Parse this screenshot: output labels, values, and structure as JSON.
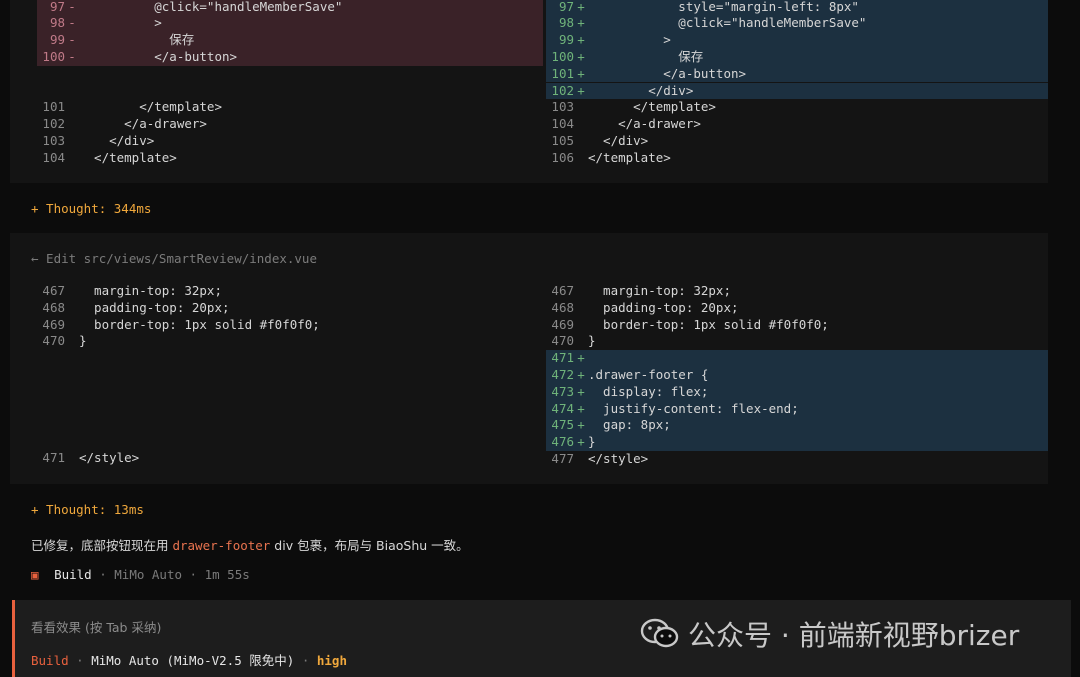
{
  "diff1": {
    "left": [
      {
        "num": "97",
        "sign": "-",
        "code": "          @click=\"handleMemberSave\"",
        "kind": "del"
      },
      {
        "num": "98",
        "sign": "-",
        "code": "          >",
        "kind": "del"
      },
      {
        "num": "99",
        "sign": "-",
        "code": "            保存",
        "kind": "del"
      },
      {
        "num": "100",
        "sign": "-",
        "code": "          </a-button>",
        "kind": "del"
      },
      {
        "num": "101",
        "sign": "",
        "code": "        </template>",
        "kind": "plain"
      },
      {
        "num": "102",
        "sign": "",
        "code": "      </a-drawer>",
        "kind": "plain"
      },
      {
        "num": "103",
        "sign": "",
        "code": "    </div>",
        "kind": "plain"
      },
      {
        "num": "104",
        "sign": "",
        "code": "  </template>",
        "kind": "plain"
      }
    ],
    "right": [
      {
        "num": "97",
        "sign": "+",
        "code": "            style=\"margin-left: 8px\"",
        "kind": "add"
      },
      {
        "num": "98",
        "sign": "+",
        "code": "            @click=\"handleMemberSave\"",
        "kind": "add"
      },
      {
        "num": "99",
        "sign": "+",
        "code": "          >",
        "kind": "add"
      },
      {
        "num": "100",
        "sign": "+",
        "code": "            保存",
        "kind": "add"
      },
      {
        "num": "101",
        "sign": "+",
        "code": "          </a-button>",
        "kind": "add"
      },
      {
        "num": "102",
        "sign": "+",
        "code": "        </div>",
        "kind": "add"
      },
      {
        "num": "103",
        "sign": "",
        "code": "      </template>",
        "kind": "plain"
      },
      {
        "num": "104",
        "sign": "",
        "code": "    </a-drawer>",
        "kind": "plain"
      },
      {
        "num": "105",
        "sign": "",
        "code": "  </div>",
        "kind": "plain"
      },
      {
        "num": "106",
        "sign": "",
        "code": "</template>",
        "kind": "plain"
      }
    ]
  },
  "thought1": "+ Thought: 344ms",
  "edit2": {
    "title": "← Edit src/views/SmartReview/index.vue",
    "left": [
      {
        "num": "467",
        "sign": "",
        "code": "  margin-top: 32px;",
        "kind": "plain"
      },
      {
        "num": "468",
        "sign": "",
        "code": "  padding-top: 20px;",
        "kind": "plain"
      },
      {
        "num": "469",
        "sign": "",
        "code": "  border-top: 1px solid #f0f0f0;",
        "kind": "plain"
      },
      {
        "num": "470",
        "sign": "",
        "code": "}",
        "kind": "plain"
      },
      {
        "num": "471",
        "sign": "",
        "code": "</style>",
        "kind": "plain"
      }
    ],
    "right": [
      {
        "num": "467",
        "sign": "",
        "code": "  margin-top: 32px;",
        "kind": "plain"
      },
      {
        "num": "468",
        "sign": "",
        "code": "  padding-top: 20px;",
        "kind": "plain"
      },
      {
        "num": "469",
        "sign": "",
        "code": "  border-top: 1px solid #f0f0f0;",
        "kind": "plain"
      },
      {
        "num": "470",
        "sign": "",
        "code": "}",
        "kind": "plain"
      },
      {
        "num": "471",
        "sign": "+",
        "code": "",
        "kind": "add"
      },
      {
        "num": "472",
        "sign": "+",
        "code": ".drawer-footer {",
        "kind": "add"
      },
      {
        "num": "473",
        "sign": "+",
        "code": "  display: flex;",
        "kind": "add"
      },
      {
        "num": "474",
        "sign": "+",
        "code": "  justify-content: flex-end;",
        "kind": "add"
      },
      {
        "num": "475",
        "sign": "+",
        "code": "  gap: 8px;",
        "kind": "add"
      },
      {
        "num": "476",
        "sign": "+",
        "code": "}",
        "kind": "add"
      },
      {
        "num": "477",
        "sign": "",
        "code": "</style>",
        "kind": "plain"
      }
    ]
  },
  "thought2": "+ Thought: 13ms",
  "message": {
    "before": "已修复，底部按钮现在用 ",
    "highlight": "drawer-footer",
    "after": " div 包裹，布局与 BiaoShu 一致。"
  },
  "status": {
    "icon": "square-stop-icon",
    "mode": "Build",
    "sep": " · ",
    "model": "MiMo Auto",
    "duration": "1m 55s"
  },
  "input": {
    "placeholder": "看看效果  (按 Tab 采纳)",
    "mode": "Build",
    "sep": " · ",
    "model": "MiMo Auto (MiMo-V2.5 限免中)",
    "sep2": " · ",
    "effort": "high"
  },
  "watermark": {
    "icon": "wechat-icon",
    "text": "公众号 · 前端新视野brizer"
  },
  "colors": {
    "accent": "#e8613e",
    "thought": "#f0a83c",
    "add_bg": "#1c3040",
    "del_bg": "#3a2228"
  }
}
